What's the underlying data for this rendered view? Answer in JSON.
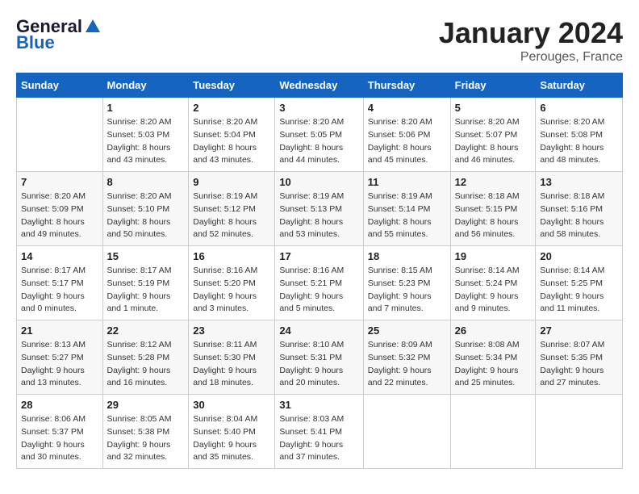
{
  "header": {
    "logo_general": "General",
    "logo_blue": "Blue",
    "title": "January 2024",
    "subtitle": "Perouges, France"
  },
  "weekdays": [
    "Sunday",
    "Monday",
    "Tuesday",
    "Wednesday",
    "Thursday",
    "Friday",
    "Saturday"
  ],
  "weeks": [
    [
      {
        "day": "",
        "info": ""
      },
      {
        "day": "1",
        "info": "Sunrise: 8:20 AM\nSunset: 5:03 PM\nDaylight: 8 hours\nand 43 minutes."
      },
      {
        "day": "2",
        "info": "Sunrise: 8:20 AM\nSunset: 5:04 PM\nDaylight: 8 hours\nand 43 minutes."
      },
      {
        "day": "3",
        "info": "Sunrise: 8:20 AM\nSunset: 5:05 PM\nDaylight: 8 hours\nand 44 minutes."
      },
      {
        "day": "4",
        "info": "Sunrise: 8:20 AM\nSunset: 5:06 PM\nDaylight: 8 hours\nand 45 minutes."
      },
      {
        "day": "5",
        "info": "Sunrise: 8:20 AM\nSunset: 5:07 PM\nDaylight: 8 hours\nand 46 minutes."
      },
      {
        "day": "6",
        "info": "Sunrise: 8:20 AM\nSunset: 5:08 PM\nDaylight: 8 hours\nand 48 minutes."
      }
    ],
    [
      {
        "day": "7",
        "info": "Sunrise: 8:20 AM\nSunset: 5:09 PM\nDaylight: 8 hours\nand 49 minutes."
      },
      {
        "day": "8",
        "info": "Sunrise: 8:20 AM\nSunset: 5:10 PM\nDaylight: 8 hours\nand 50 minutes."
      },
      {
        "day": "9",
        "info": "Sunrise: 8:19 AM\nSunset: 5:12 PM\nDaylight: 8 hours\nand 52 minutes."
      },
      {
        "day": "10",
        "info": "Sunrise: 8:19 AM\nSunset: 5:13 PM\nDaylight: 8 hours\nand 53 minutes."
      },
      {
        "day": "11",
        "info": "Sunrise: 8:19 AM\nSunset: 5:14 PM\nDaylight: 8 hours\nand 55 minutes."
      },
      {
        "day": "12",
        "info": "Sunrise: 8:18 AM\nSunset: 5:15 PM\nDaylight: 8 hours\nand 56 minutes."
      },
      {
        "day": "13",
        "info": "Sunrise: 8:18 AM\nSunset: 5:16 PM\nDaylight: 8 hours\nand 58 minutes."
      }
    ],
    [
      {
        "day": "14",
        "info": "Sunrise: 8:17 AM\nSunset: 5:17 PM\nDaylight: 9 hours\nand 0 minutes."
      },
      {
        "day": "15",
        "info": "Sunrise: 8:17 AM\nSunset: 5:19 PM\nDaylight: 9 hours\nand 1 minute."
      },
      {
        "day": "16",
        "info": "Sunrise: 8:16 AM\nSunset: 5:20 PM\nDaylight: 9 hours\nand 3 minutes."
      },
      {
        "day": "17",
        "info": "Sunrise: 8:16 AM\nSunset: 5:21 PM\nDaylight: 9 hours\nand 5 minutes."
      },
      {
        "day": "18",
        "info": "Sunrise: 8:15 AM\nSunset: 5:23 PM\nDaylight: 9 hours\nand 7 minutes."
      },
      {
        "day": "19",
        "info": "Sunrise: 8:14 AM\nSunset: 5:24 PM\nDaylight: 9 hours\nand 9 minutes."
      },
      {
        "day": "20",
        "info": "Sunrise: 8:14 AM\nSunset: 5:25 PM\nDaylight: 9 hours\nand 11 minutes."
      }
    ],
    [
      {
        "day": "21",
        "info": "Sunrise: 8:13 AM\nSunset: 5:27 PM\nDaylight: 9 hours\nand 13 minutes."
      },
      {
        "day": "22",
        "info": "Sunrise: 8:12 AM\nSunset: 5:28 PM\nDaylight: 9 hours\nand 16 minutes."
      },
      {
        "day": "23",
        "info": "Sunrise: 8:11 AM\nSunset: 5:30 PM\nDaylight: 9 hours\nand 18 minutes."
      },
      {
        "day": "24",
        "info": "Sunrise: 8:10 AM\nSunset: 5:31 PM\nDaylight: 9 hours\nand 20 minutes."
      },
      {
        "day": "25",
        "info": "Sunrise: 8:09 AM\nSunset: 5:32 PM\nDaylight: 9 hours\nand 22 minutes."
      },
      {
        "day": "26",
        "info": "Sunrise: 8:08 AM\nSunset: 5:34 PM\nDaylight: 9 hours\nand 25 minutes."
      },
      {
        "day": "27",
        "info": "Sunrise: 8:07 AM\nSunset: 5:35 PM\nDaylight: 9 hours\nand 27 minutes."
      }
    ],
    [
      {
        "day": "28",
        "info": "Sunrise: 8:06 AM\nSunset: 5:37 PM\nDaylight: 9 hours\nand 30 minutes."
      },
      {
        "day": "29",
        "info": "Sunrise: 8:05 AM\nSunset: 5:38 PM\nDaylight: 9 hours\nand 32 minutes."
      },
      {
        "day": "30",
        "info": "Sunrise: 8:04 AM\nSunset: 5:40 PM\nDaylight: 9 hours\nand 35 minutes."
      },
      {
        "day": "31",
        "info": "Sunrise: 8:03 AM\nSunset: 5:41 PM\nDaylight: 9 hours\nand 37 minutes."
      },
      {
        "day": "",
        "info": ""
      },
      {
        "day": "",
        "info": ""
      },
      {
        "day": "",
        "info": ""
      }
    ]
  ]
}
